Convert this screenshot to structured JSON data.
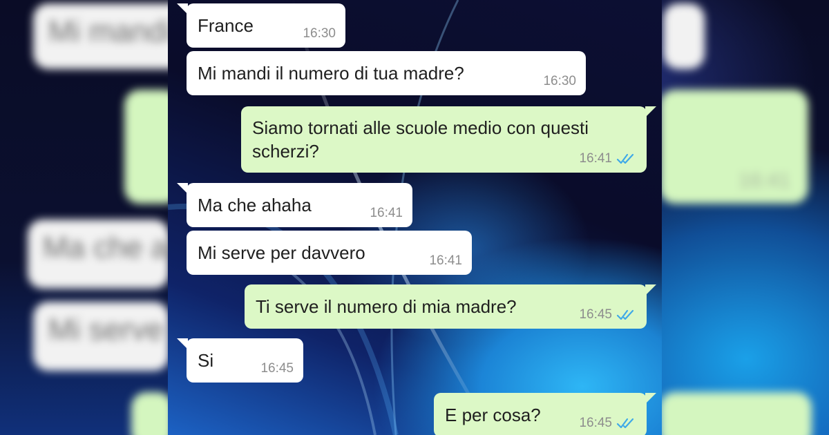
{
  "colors": {
    "incoming_bubble": "#ffffff",
    "outgoing_bubble": "#dcf8c6",
    "read_ticks": "#3fa9e8",
    "timestamp": "#8d8d8d"
  },
  "icons": {
    "read_receipt": "double-check-icon"
  },
  "messages": [
    {
      "direction": "incoming",
      "text": "France",
      "time": "16:30"
    },
    {
      "direction": "incoming",
      "text": "Mi mandi il numero di tua madre?",
      "time": "16:30"
    },
    {
      "direction": "outgoing",
      "text_line1": "Siamo tornati alle scuole medio con questi",
      "text_line2": "scherzi?",
      "time": "16:41",
      "read": true
    },
    {
      "direction": "incoming",
      "text": "Ma che ahaha",
      "time": "16:41"
    },
    {
      "direction": "incoming",
      "text": "Mi serve per davvero",
      "time": "16:41"
    },
    {
      "direction": "outgoing",
      "text": "Ti serve il numero di mia madre?",
      "time": "16:45",
      "read": true
    },
    {
      "direction": "incoming",
      "text": "Si",
      "time": "16:45"
    },
    {
      "direction": "outgoing",
      "text": "E per cosa?",
      "time": "16:45",
      "read": true
    }
  ]
}
